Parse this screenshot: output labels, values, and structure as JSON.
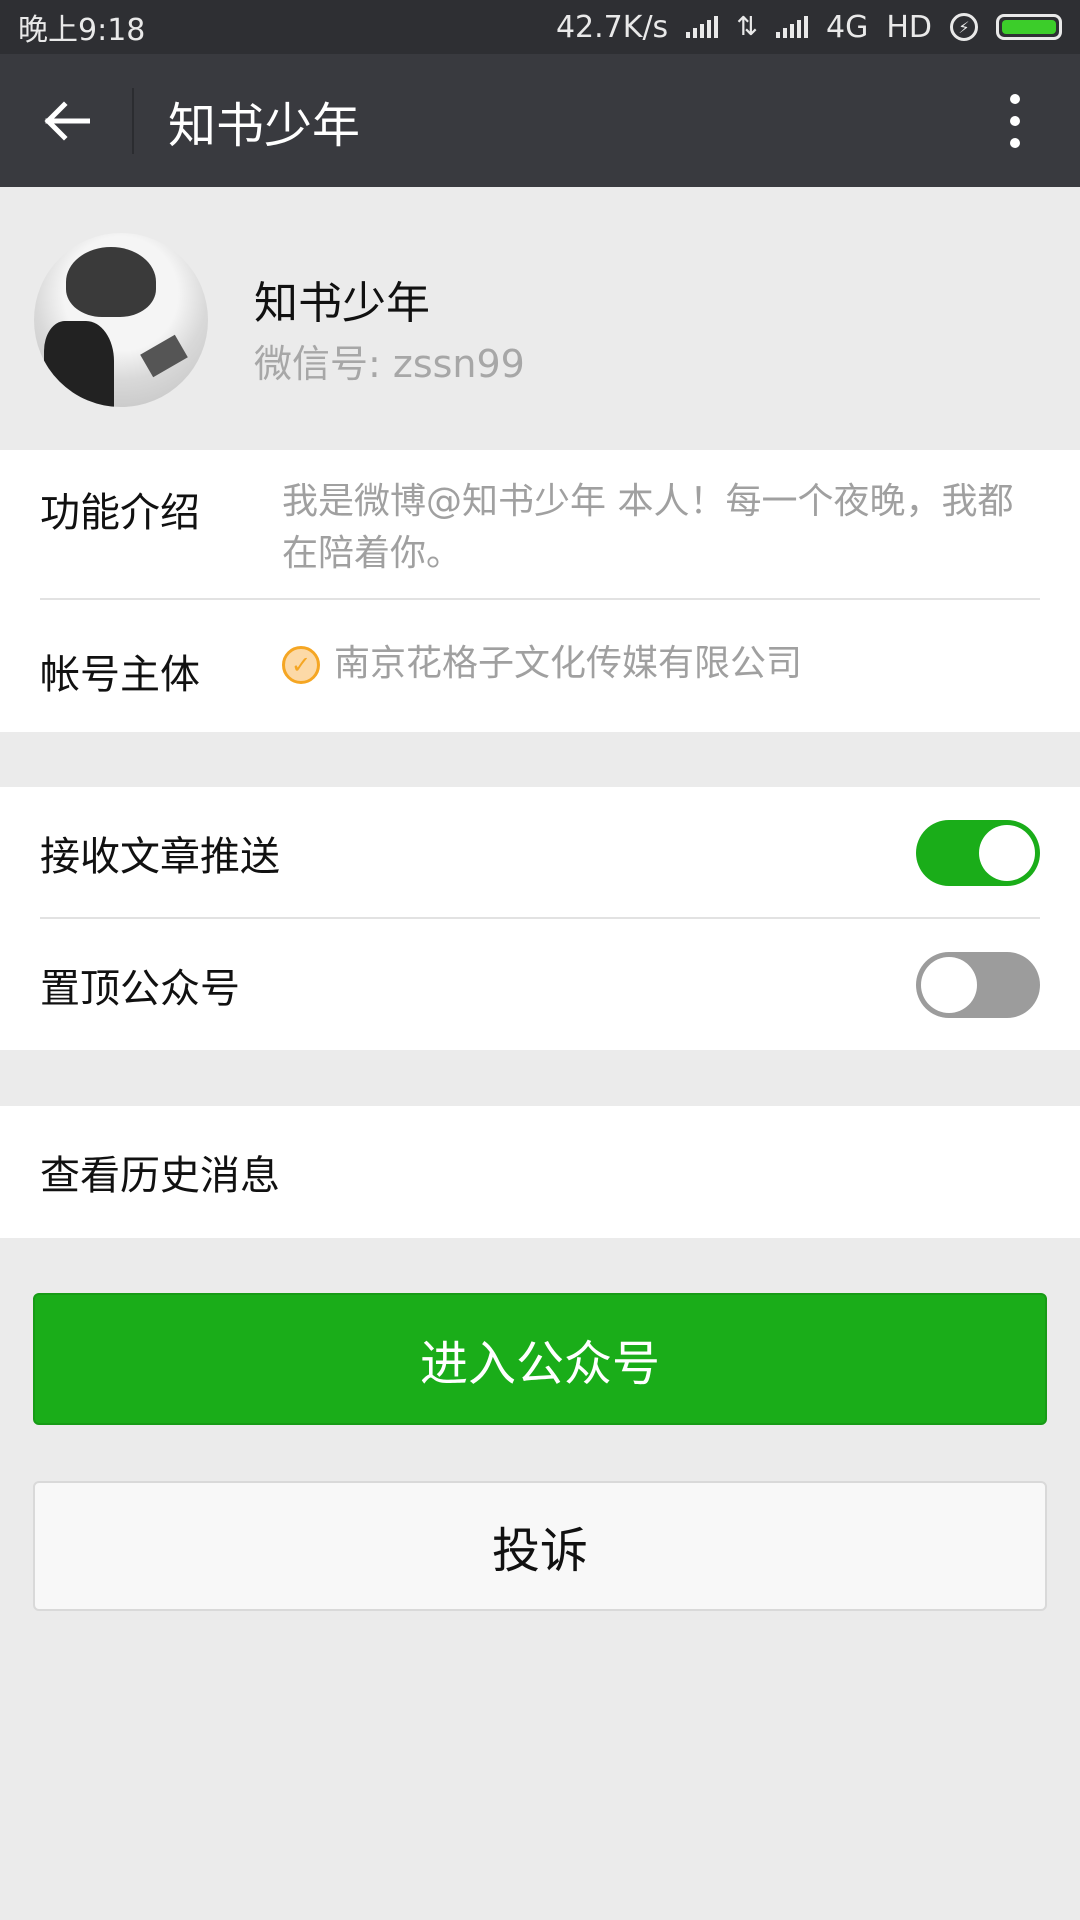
{
  "status_bar": {
    "time": "晚上9:18",
    "speed": "42.7K/s",
    "network": "4G",
    "hd": "HD"
  },
  "app_bar": {
    "title": "知书少年",
    "back_icon": "arrow-left-icon",
    "more_icon": "more-vertical-icon"
  },
  "profile": {
    "name": "知书少年",
    "wechat_id": "微信号: zssn99"
  },
  "info": {
    "intro_label": "功能介绍",
    "intro_value": "我是微博@知书少年 本人！每一个夜晚，我都在陪着你。",
    "account_label": "帐号主体",
    "account_value": "南京花格子文化传媒有限公司"
  },
  "settings": {
    "receive_push_label": "接收文章推送",
    "receive_push_on": true,
    "pin_label": "置顶公众号",
    "pin_on": false
  },
  "history": {
    "label": "查看历史消息"
  },
  "buttons": {
    "enter_label": "进入公众号",
    "complain_label": "投诉"
  },
  "colors": {
    "primary_green": "#1aad19",
    "toolbar_dark": "#393a3f",
    "verified_orange": "#f5a623"
  }
}
